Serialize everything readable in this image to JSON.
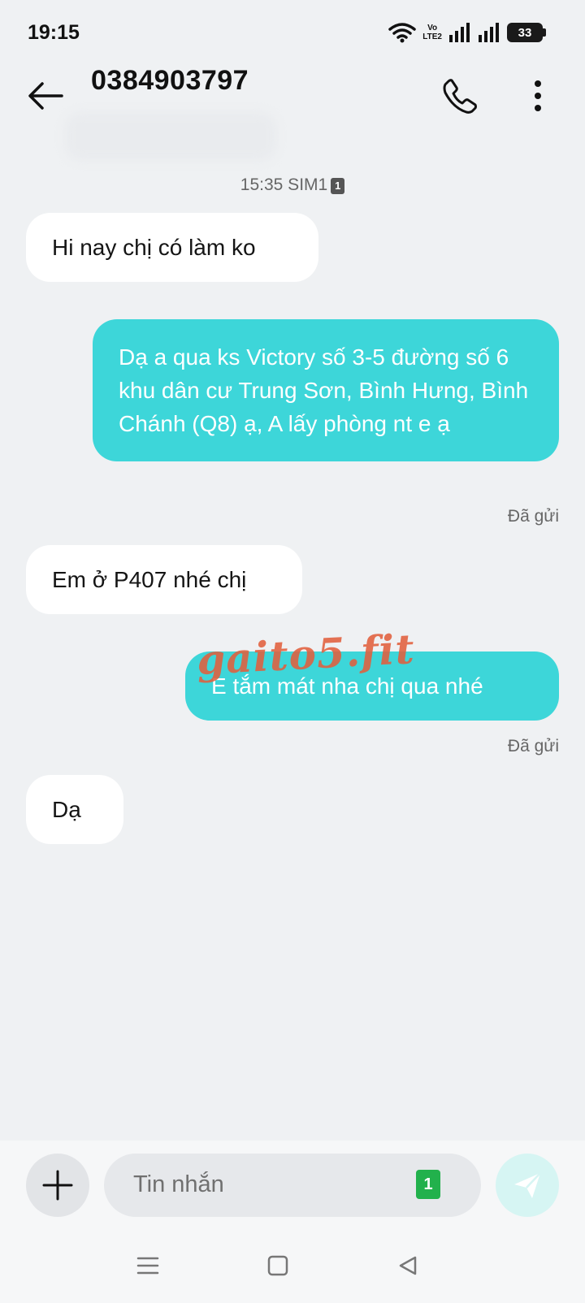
{
  "status_bar": {
    "time": "19:15",
    "volte_top": "Vo",
    "volte_bottom": "LTE2",
    "battery_level": "33"
  },
  "header": {
    "contact": "0384903797",
    "back_icon": "arrow-left-icon",
    "call_icon": "phone-icon",
    "more_icon": "more-vertical-icon"
  },
  "conversation": {
    "timestamp": "15:35 SIM1",
    "sim_badge": "1",
    "messages": [
      {
        "direction": "in",
        "text": "Hi nay chị có làm ko"
      },
      {
        "direction": "out",
        "text": "Dạ a qua ks Victory số 3-5 đường số 6 khu dân cư Trung Sơn, Bình Hưng, Bình Chánh (Q8) ạ, A lấy phòng nt e ạ",
        "status": "Đã gửi"
      },
      {
        "direction": "in",
        "text": "Em ở P407 nhé chị"
      },
      {
        "direction": "out",
        "text": "E tắm mát nha chị qua nhé",
        "status": "Đã gửi"
      },
      {
        "direction": "in",
        "text": "Dạ"
      }
    ]
  },
  "watermark": "gaito5.fit",
  "composer": {
    "placeholder": "Tin nhắn",
    "sim_chip": "1",
    "add_icon": "plus-icon",
    "send_icon": "send-icon"
  },
  "colors": {
    "outgoing_bubble": "#3dd6d9",
    "incoming_bubble": "#ffffff",
    "background": "#eff1f3",
    "sim_chip": "#22b14c"
  }
}
